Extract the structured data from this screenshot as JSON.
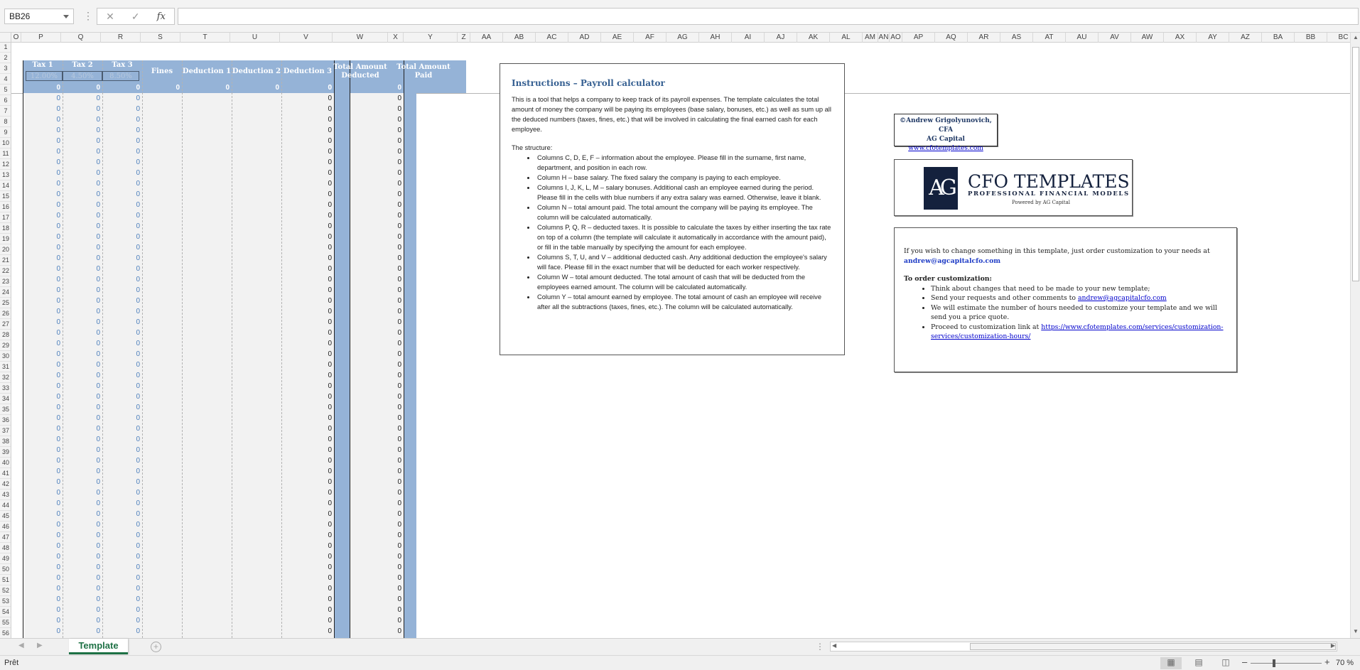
{
  "formula_bar": {
    "name_box": "BB26",
    "formula": "",
    "fx_label": "fx",
    "cancel_glyph": "✕",
    "enter_glyph": "✓",
    "separator": "⋮"
  },
  "columns": [
    "O",
    "P",
    "Q",
    "R",
    "S",
    "T",
    "U",
    "V",
    "W",
    "X",
    "Y",
    "Z",
    "AA",
    "AB",
    "AC",
    "AD",
    "AE",
    "AF",
    "AG",
    "AH",
    "AI",
    "AJ",
    "AK",
    "AL",
    "AM",
    "AN",
    "AO",
    "AP",
    "AQ",
    "AR",
    "AS",
    "AT",
    "AU",
    "AV",
    "AW",
    "AX",
    "AY",
    "AZ",
    "BA",
    "BB",
    "BC"
  ],
  "rows": [
    "1",
    "2",
    "3",
    "4",
    "5",
    "6",
    "7",
    "8",
    "9",
    "10",
    "11",
    "12",
    "13",
    "14",
    "15",
    "16",
    "17",
    "18",
    "19",
    "20",
    "21",
    "22",
    "23",
    "24",
    "25",
    "26",
    "27",
    "28",
    "29",
    "30",
    "31",
    "32",
    "33",
    "34",
    "35",
    "36",
    "37",
    "38",
    "39",
    "40",
    "41",
    "42",
    "43",
    "44",
    "45",
    "46",
    "47",
    "48",
    "49",
    "50",
    "51",
    "52",
    "53",
    "54",
    "55",
    "56"
  ],
  "payroll": {
    "headers": {
      "tax1": "Tax 1",
      "tax2": "Tax 2",
      "tax3": "Tax 3",
      "fines": "Fines",
      "deduction1": "Deduction 1",
      "deduction2": "Deduction 2",
      "deduction3": "Deduction 3",
      "total_deducted": "Total Amount Deducted",
      "total_paid": "Total Amount Paid"
    },
    "rates": {
      "tax1": "12.00%",
      "tax2": "4.50%",
      "tax3": "8.50%"
    },
    "totals": [
      "0",
      "0",
      "0",
      "0",
      "0",
      "0",
      "0",
      "0",
      "0"
    ],
    "cell_value": "0",
    "data_row_count": 51
  },
  "instructions": {
    "title": "Instructions – Payroll calculator",
    "intro": "This is a tool that helps a company to keep track of its payroll expenses. The template calculates the total amount of money the company will be paying its employees (base salary, bonuses, etc.) as well as sum up all the deduced numbers (taxes, fines, etc.) that will be involved in calculating the final earned cash for each employee.",
    "structure_label": "The structure:",
    "items": [
      "Columns C, D, E, F – information about the employee. Please fill in the surname, first name, department, and position in each row.",
      "Column H – base salary. The fixed salary the company is paying to each employee.",
      "Columns I, J, K, L, M – salary bonuses. Additional cash an employee earned during the period. Please fill in the cells with blue numbers if any extra salary was earned. Otherwise, leave it blank.",
      "Column N – total amount paid. The total amount the company will be paying its employee. The column will be calculated automatically.",
      "Columns P, Q, R – deducted taxes. It is possible to calculate the taxes by either inserting the tax rate on top of a column (the template will calculate it automatically in accordance with the amount paid), or fill in the table manually by specifying the amount for each employee.",
      "Columns S, T, U, and V – additional deducted cash. Any additional deduction the employee's salary will face. Please fill in the exact number that will be deducted for each worker respectively.",
      "Column W – total amount deducted. The total amount of cash that will be deducted from the employees earned amount. The column will be calculated automatically.",
      "Column Y – total amount earned by employee. The total amount of cash an employee will receive after all the subtractions (taxes, fines, etc.). The column will be calculated automatically."
    ]
  },
  "copyright": {
    "author": "©Andrew Grigolyunovich, CFA",
    "company": "AG Capital",
    "website": "www.cfotemplates.com"
  },
  "logo": {
    "mark": "AG",
    "title": "CFO TEMPLATES",
    "subtitle": "PROFESSIONAL FINANCIAL MODELS",
    "powered": "Powered by  AG Capital"
  },
  "customize": {
    "intro": "If you wish to change something in this template, just order customization to your needs at",
    "email": "andrew@agcapitalcfo.com",
    "order_label": "To order customization:",
    "item1": "Think about changes that need to be made to your new template;",
    "item2_text": "Send your requests and other comments to ",
    "item2_link": "andrew@agcapitalcfo.com",
    "item3": "We will estimate the number of hours needed to customize your template and we will send you a price quote.",
    "item4_text": "Proceed to customization link at ",
    "item4_link": "https://www.cfotemplates.com/services/customization-services/customization-hours/"
  },
  "tabs": {
    "sheet_name": "Template",
    "add_label": "+",
    "dots": "⋮"
  },
  "status": {
    "ready": "Prêt",
    "zoom": "70 %",
    "zoom_minus": "–",
    "zoom_plus": "+"
  }
}
